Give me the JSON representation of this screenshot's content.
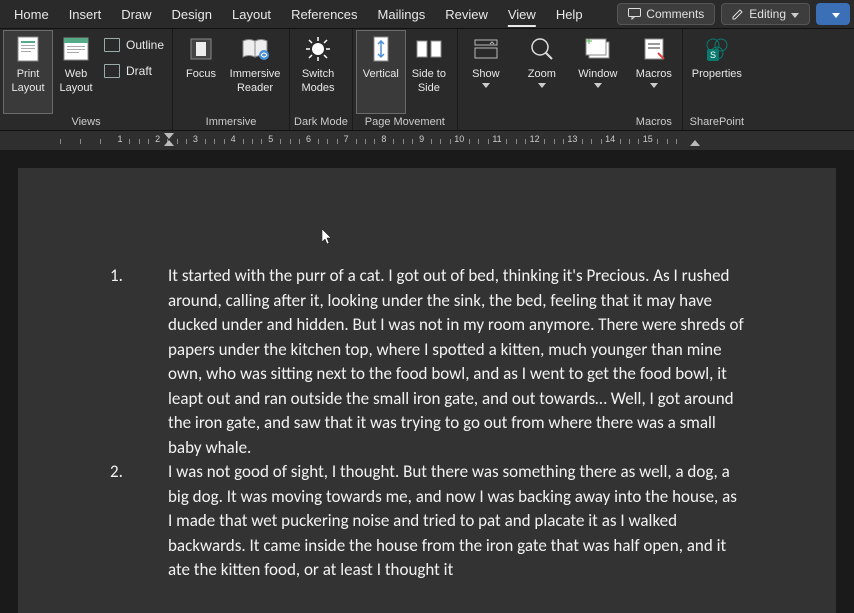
{
  "menu": {
    "tabs": [
      "Home",
      "Insert",
      "Draw",
      "Design",
      "Layout",
      "References",
      "Mailings",
      "Review",
      "View",
      "Help"
    ],
    "active": "View",
    "comments": "Comments",
    "editing": "Editing"
  },
  "ribbon": {
    "views": {
      "print": "Print Layout",
      "web": "Web Layout",
      "outline": "Outline",
      "draft": "Draft",
      "label": "Views"
    },
    "immersive": {
      "focus": "Focus",
      "reader": "Immersive Reader",
      "label": "Immersive"
    },
    "darkmode": {
      "switch": "Switch Modes",
      "label": "Dark Mode"
    },
    "pagemove": {
      "vertical": "Vertical",
      "side": "Side to Side",
      "label": "Page Movement"
    },
    "show": "Show",
    "zoom": "Zoom",
    "window": "Window",
    "macros": {
      "btn": "Macros",
      "label": "Macros"
    },
    "sharepoint": {
      "btn": "Properties",
      "label": "SharePoint"
    }
  },
  "ruler": {
    "nums": [
      "1",
      "2",
      "3",
      "4",
      "5",
      "6",
      "7",
      "8",
      "9",
      "10",
      "11",
      "12",
      "13",
      "14",
      "15"
    ]
  },
  "doc": {
    "items": [
      {
        "n": "1.",
        "t": "It started with the purr of a cat. I got out of bed, thinking it's Precious. As I rushed around, calling after it, looking under the sink, the bed, feeling that it may have ducked under and hidden. But I was not in my room anymore. There were shreds of papers under the kitchen top, where I spotted a kitten, much younger than mine own, who was sitting next to the food bowl, and as I went to get the food bowl, it leapt out and ran outside the small iron gate, and out towards… Well, I got around the iron gate, and saw that it was trying to go out from where there was a small baby whale."
      },
      {
        "n": "2.",
        "t": "I was not good of sight, I thought. But there was something there as well, a dog, a big dog. It was moving towards me, and now I was backing away into the house, as I made that wet puckering noise and tried to pat and placate it as I walked backwards. It came inside the house from the iron gate that was half open, and it ate the kitten food, or at least I thought it"
      }
    ]
  }
}
